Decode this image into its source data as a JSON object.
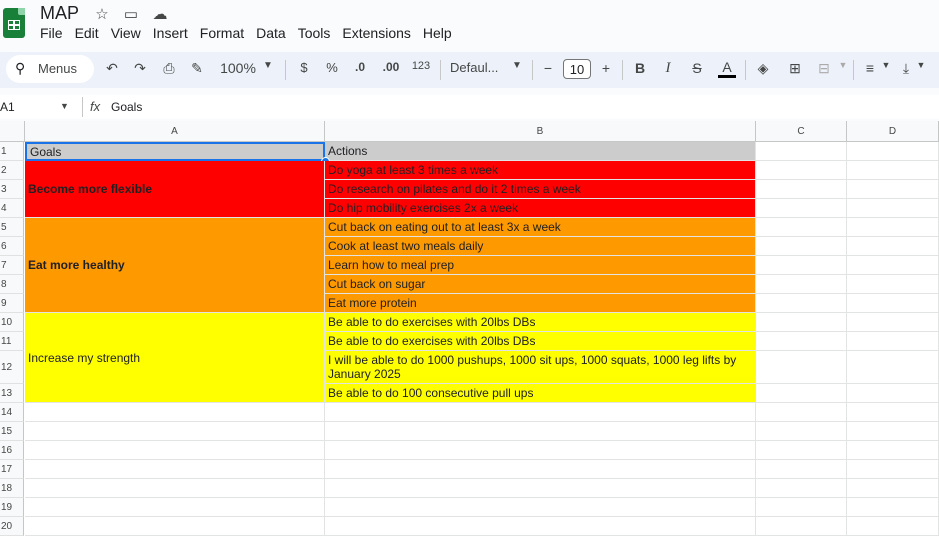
{
  "doc": {
    "title": "MAP"
  },
  "menu": [
    "File",
    "Edit",
    "View",
    "Insert",
    "Format",
    "Data",
    "Tools",
    "Extensions",
    "Help"
  ],
  "toolbar": {
    "search_label": "Menus",
    "zoom": "100%",
    "currency": "$",
    "percent": "%",
    "dec_decrease": ".0",
    "dec_increase": ".00",
    "number_format": "123",
    "font": "Defaul...",
    "font_size": "10",
    "bold": "B",
    "italic": "I",
    "strike": "S",
    "text_color": "A"
  },
  "formula_bar": {
    "cell_ref": "A1",
    "fx": "fx",
    "value": "Goals"
  },
  "columns": [
    "A",
    "B",
    "C",
    "D"
  ],
  "rows": [
    "1",
    "2",
    "3",
    "4",
    "5",
    "6",
    "7",
    "8",
    "9",
    "10",
    "11",
    "12",
    "13",
    "14",
    "15",
    "16",
    "17",
    "18",
    "19",
    "20"
  ],
  "colors": {
    "header_fill": "#cccccc",
    "red": "#ff0000",
    "orange": "#ff9900",
    "yellow": "#ffff00",
    "selection": "#1a73e8"
  },
  "sheet": {
    "header": {
      "goals": "Goals",
      "actions": "Actions"
    },
    "goals": [
      {
        "label": "Become more flexible"
      },
      {
        "label": "Eat more healthy"
      },
      {
        "label": "Increase my strength"
      }
    ],
    "actions": [
      "Do yoga at least 3 times a week",
      "Do research on pilates and do it 2 times a week",
      "Do hip mobility exercises 2x a week",
      "Cut back on eating out to at least 3x a week",
      "Cook at least two meals daily",
      "Learn how to meal prep",
      "Cut back on sugar",
      "Eat more protein",
      "Be able to do exercises with 20lbs DBs",
      "Be able to do exercises with 20lbs DBs",
      "I will be able to do 1000 pushups, 1000 sit ups, 1000 squats, 1000 leg lifts by January 2025",
      "Be able to do 100 consecutive pull ups"
    ]
  }
}
